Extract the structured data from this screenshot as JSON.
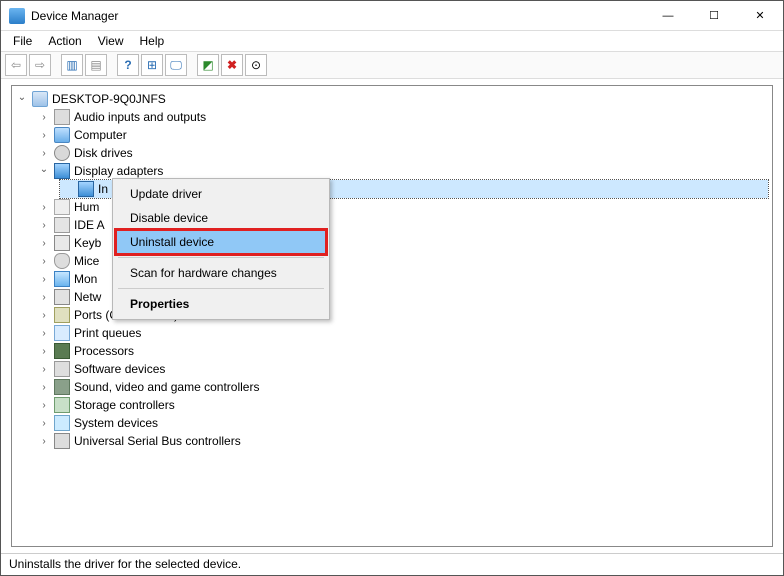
{
  "window": {
    "title": "Device Manager"
  },
  "menu": {
    "file": "File",
    "action": "Action",
    "view": "View",
    "help": "Help"
  },
  "toolbar": {
    "back": "←",
    "fwd": "→",
    "props": "▥",
    "list": "▤",
    "help": "?",
    "cal": "⊞",
    "mon": "🖵",
    "add": "▣",
    "del": "✖",
    "scan": "⊙"
  },
  "tree": {
    "root": "DESKTOP-9Q0JNFS",
    "items": [
      {
        "label": "Audio inputs and outputs",
        "icon": "ic-audio",
        "arrow": "collapsed"
      },
      {
        "label": "Computer",
        "icon": "ic-computer",
        "arrow": "collapsed"
      },
      {
        "label": "Disk drives",
        "icon": "ic-disk",
        "arrow": "collapsed"
      },
      {
        "label": "Display adapters",
        "icon": "ic-display",
        "arrow": "expanded"
      },
      {
        "label": "Human Interface Devices",
        "icon": "ic-hid",
        "arrow": "collapsed",
        "truncated": "Hum"
      },
      {
        "label": "IDE ATA/ATAPI controllers",
        "icon": "ic-ide",
        "arrow": "collapsed",
        "truncated": "IDE A"
      },
      {
        "label": "Keyboards",
        "icon": "ic-keyboard",
        "arrow": "collapsed",
        "truncated": "Keyb"
      },
      {
        "label": "Mice and other pointing devices",
        "icon": "ic-mouse",
        "arrow": "collapsed",
        "truncated": "Mice"
      },
      {
        "label": "Monitors",
        "icon": "ic-monitor",
        "arrow": "collapsed",
        "truncated": "Mon"
      },
      {
        "label": "Network adapters",
        "icon": "ic-network",
        "arrow": "collapsed",
        "truncated": "Netw"
      },
      {
        "label": "Ports (COM & LPT)",
        "icon": "ic-ports",
        "arrow": "collapsed"
      },
      {
        "label": "Print queues",
        "icon": "ic-print",
        "arrow": "collapsed"
      },
      {
        "label": "Processors",
        "icon": "ic-cpu",
        "arrow": "collapsed"
      },
      {
        "label": "Software devices",
        "icon": "ic-soft",
        "arrow": "collapsed"
      },
      {
        "label": "Sound, video and game controllers",
        "icon": "ic-sound",
        "arrow": "collapsed"
      },
      {
        "label": "Storage controllers",
        "icon": "ic-storage",
        "arrow": "collapsed"
      },
      {
        "label": "System devices",
        "icon": "ic-system",
        "arrow": "collapsed"
      },
      {
        "label": "Universal Serial Bus controllers",
        "icon": "ic-usb",
        "arrow": "collapsed"
      }
    ],
    "display_child": "In"
  },
  "context_menu": {
    "update": "Update driver",
    "disable": "Disable device",
    "uninstall": "Uninstall device",
    "scan": "Scan for hardware changes",
    "properties": "Properties"
  },
  "status": "Uninstalls the driver for the selected device."
}
